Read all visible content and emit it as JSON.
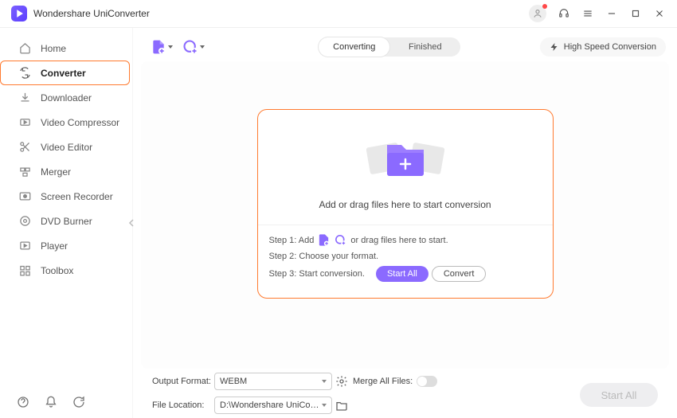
{
  "app": {
    "title": "Wondershare UniConverter"
  },
  "sidebar": {
    "items": [
      {
        "label": "Home"
      },
      {
        "label": "Converter"
      },
      {
        "label": "Downloader"
      },
      {
        "label": "Video Compressor"
      },
      {
        "label": "Video Editor"
      },
      {
        "label": "Merger"
      },
      {
        "label": "Screen Recorder"
      },
      {
        "label": "DVD Burner"
      },
      {
        "label": "Player"
      },
      {
        "label": "Toolbox"
      }
    ]
  },
  "tabs": {
    "converting": "Converting",
    "finished": "Finished"
  },
  "toolbar": {
    "high_speed": "High Speed Conversion"
  },
  "drop": {
    "headline": "Add or drag files here to start conversion",
    "step1_a": "Step 1: Add",
    "step1_b": "or drag files here to start.",
    "step2": "Step 2: Choose your format.",
    "step3": "Step 3: Start conversion.",
    "start_all": "Start All",
    "convert": "Convert"
  },
  "footer": {
    "output_label": "Output Format:",
    "output_value": "WEBM",
    "merge_label": "Merge All Files:",
    "location_label": "File Location:",
    "location_value": "D:\\Wondershare UniConverter",
    "start_all": "Start All"
  }
}
